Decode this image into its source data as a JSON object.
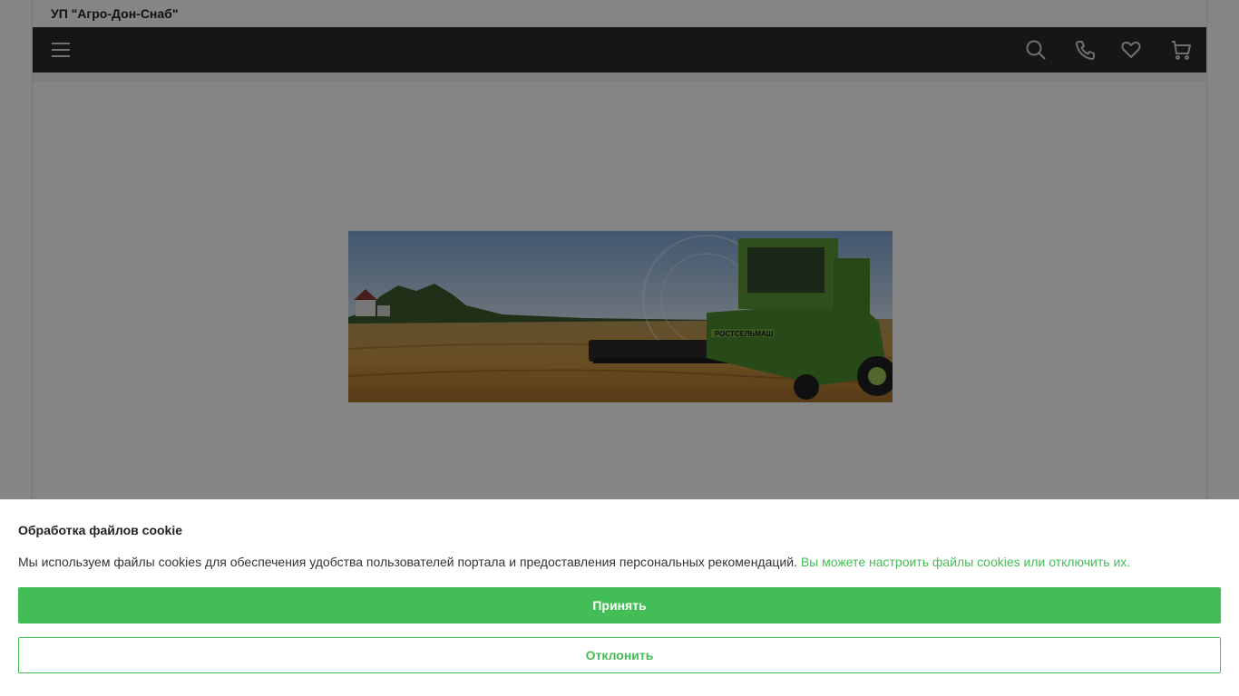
{
  "header": {
    "company_name": "УП \"Агро-Дон-Снаб\""
  },
  "navbar": {
    "icons": [
      "menu-icon",
      "search-icon",
      "phone-icon",
      "heart-icon",
      "cart-icon"
    ]
  },
  "banner": {
    "image": "harvester-in-wheat-field",
    "machine_label": "РОСТСЕЛЬМАШ"
  },
  "cookie_notice": {
    "title": "Обработка файлов cookie",
    "text": "Мы используем файлы cookies для обеспечения удобства пользователей портала и предоставления персональных рекомендаций.",
    "settings_link": "Вы можете настроить файлы cookies или отключить их.",
    "accept_label": "Принять",
    "decline_label": "Отклонить"
  },
  "colors": {
    "accent_green": "#43be57",
    "navbar_bg": "#2b2b2b",
    "overlay": "rgba(0,0,0,0.48)"
  }
}
